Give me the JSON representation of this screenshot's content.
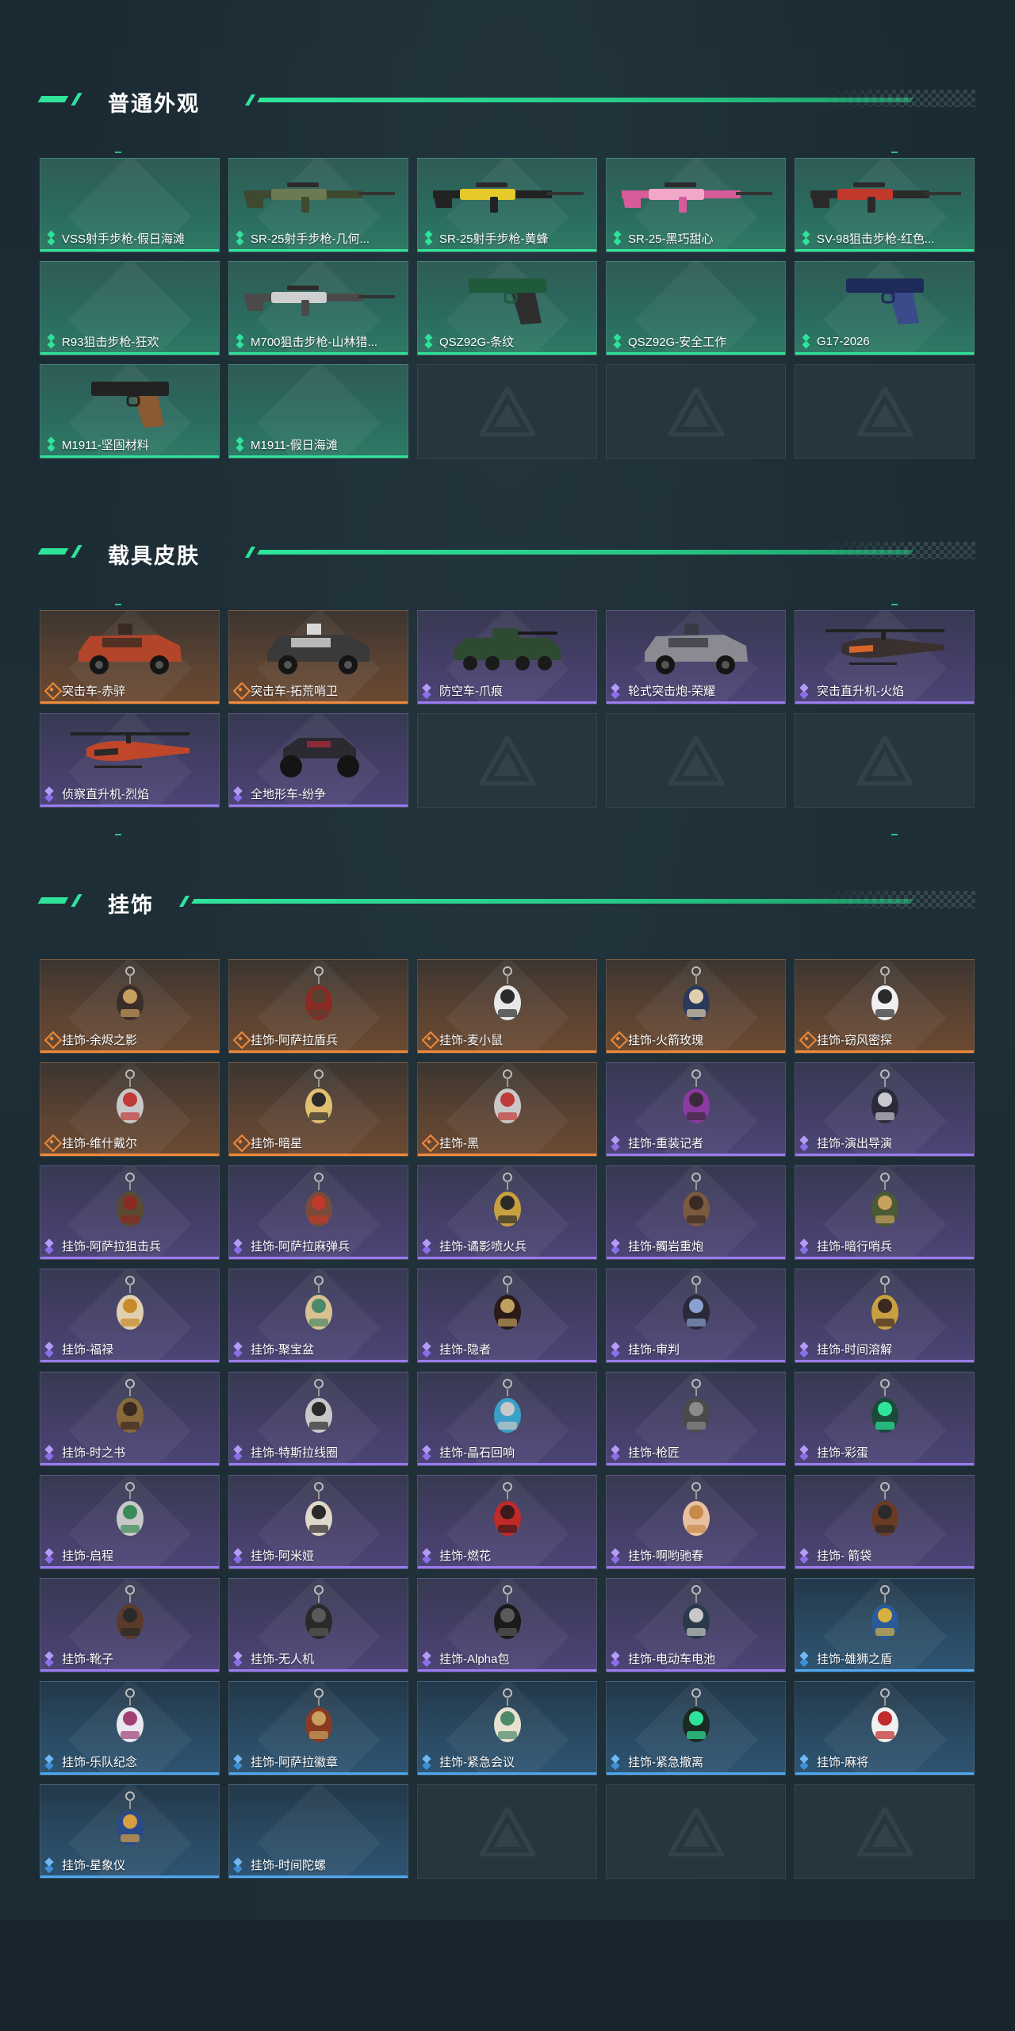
{
  "sections": {
    "weapons": {
      "title": "普通外观",
      "items": [
        {
          "label": "VSS射手步枪-假日海滩",
          "rarity": "green",
          "icon": "none"
        },
        {
          "label": "SR-25射手步枪-几何...",
          "rarity": "green",
          "icon": "rifle-icon",
          "colors": [
            "#3d4a2f",
            "#6b7a52"
          ]
        },
        {
          "label": "SR-25射手步枪-黄蜂",
          "rarity": "green",
          "icon": "rifle-icon",
          "colors": [
            "#222222",
            "#e6c92a"
          ]
        },
        {
          "label": "SR-25-黑巧甜心",
          "rarity": "green",
          "icon": "rifle-icon",
          "colors": [
            "#d75a9a",
            "#f2a6c8"
          ]
        },
        {
          "label": "SV-98狙击步枪-红色...",
          "rarity": "green",
          "icon": "rifle-icon",
          "colors": [
            "#2a2a2a",
            "#c0392b"
          ]
        },
        {
          "label": "R93狙击步枪-狂欢",
          "rarity": "green",
          "icon": "none"
        },
        {
          "label": "M700狙击步枪-山林猎...",
          "rarity": "green",
          "icon": "rifle-icon",
          "colors": [
            "#4a4a4a",
            "#cfcfcf"
          ]
        },
        {
          "label": "QSZ92G-条纹",
          "rarity": "green",
          "icon": "pistol-icon",
          "colors": [
            "#1f5a3a",
            "#2e2e2e"
          ]
        },
        {
          "label": "QSZ92G-安全工作",
          "rarity": "green",
          "icon": "none"
        },
        {
          "label": "G17-2026",
          "rarity": "green",
          "icon": "pistol-icon",
          "colors": [
            "#1e2a5a",
            "#3a4a8a"
          ]
        },
        {
          "label": "M1911-坚固材料",
          "rarity": "green",
          "icon": "pistol-icon",
          "colors": [
            "#222222",
            "#8a5a32"
          ]
        },
        {
          "label": "M1911-假日海滩",
          "rarity": "green",
          "icon": "none"
        },
        {
          "empty": true
        },
        {
          "empty": true
        },
        {
          "empty": true
        }
      ]
    },
    "vehicles": {
      "title": "载具皮肤",
      "items": [
        {
          "label": "突击车-赤骍",
          "rarity": "orange",
          "icon": "armored-car-icon",
          "colors": [
            "#b2452a",
            "#3a2a22"
          ]
        },
        {
          "label": "突击车-拓荒哨卫",
          "rarity": "orange",
          "icon": "armored-car-icon",
          "colors": [
            "#3a3a3a",
            "#d8d8d8"
          ]
        },
        {
          "label": "防空车-爪痕",
          "rarity": "purple",
          "icon": "apc-icon",
          "colors": [
            "#2e4a30",
            "#1a1a1a"
          ]
        },
        {
          "label": "轮式突击炮-荣耀",
          "rarity": "purple",
          "icon": "armored-car-icon",
          "colors": [
            "#8a8a92",
            "#3a3a44"
          ]
        },
        {
          "label": "突击直升机-火焰",
          "rarity": "purple",
          "icon": "helicopter-icon",
          "colors": [
            "#3a3030",
            "#d8662a"
          ]
        },
        {
          "label": "侦察直升机-烈焰",
          "rarity": "purple",
          "icon": "helicopter-icon",
          "colors": [
            "#c0462a",
            "#2a2a2a"
          ]
        },
        {
          "label": "全地形车-纷争",
          "rarity": "purple",
          "icon": "atv-icon",
          "colors": [
            "#2a2a30",
            "#8a2a3a"
          ]
        },
        {
          "empty": true
        },
        {
          "empty": true
        },
        {
          "empty": true
        }
      ]
    },
    "charms": {
      "title": "挂饰",
      "items": [
        {
          "label": "挂饰-余烬之影",
          "rarity": "orange",
          "icon": "charm-icon",
          "colors": [
            "#3a2e28",
            "#c8a060"
          ]
        },
        {
          "label": "挂饰-阿萨拉盾兵",
          "rarity": "orange",
          "icon": "charm-icon",
          "colors": [
            "#8a2a22",
            "#5a4030"
          ]
        },
        {
          "label": "挂饰-麦小鼠",
          "rarity": "orange",
          "icon": "charm-icon",
          "colors": [
            "#e8e8e8",
            "#2a2a2a"
          ]
        },
        {
          "label": "挂饰-火箭玫瑰",
          "rarity": "orange",
          "icon": "charm-icon",
          "colors": [
            "#2a3a5a",
            "#e0d0b0"
          ]
        },
        {
          "label": "挂饰-窃风密探",
          "rarity": "orange",
          "icon": "charm-icon",
          "colors": [
            "#f0f0f0",
            "#2a2a2a"
          ]
        },
        {
          "label": "挂饰-维什戴尔",
          "rarity": "orange",
          "icon": "charm-icon",
          "colors": [
            "#c8c8c8",
            "#c03a3a"
          ]
        },
        {
          "label": "挂饰-暗星",
          "rarity": "orange",
          "icon": "charm-icon",
          "colors": [
            "#e0c070",
            "#2a2a2a"
          ]
        },
        {
          "label": "挂饰-黑",
          "rarity": "orange",
          "icon": "charm-icon",
          "colors": [
            "#c8c8c8",
            "#c03a3a"
          ]
        },
        {
          "label": "挂饰-重装记者",
          "rarity": "purple",
          "icon": "charm-icon",
          "colors": [
            "#8a3aa0",
            "#3a2a3a"
          ]
        },
        {
          "label": "挂饰-演出导演",
          "rarity": "purple",
          "icon": "charm-icon",
          "colors": [
            "#2a2a3a",
            "#c8c8d0"
          ]
        },
        {
          "label": "挂饰-阿萨拉狙击兵",
          "rarity": "purple",
          "icon": "charm-icon",
          "colors": [
            "#5a4a32",
            "#8a2a22"
          ]
        },
        {
          "label": "挂饰-阿萨拉麻弹兵",
          "rarity": "purple",
          "icon": "charm-icon",
          "colors": [
            "#7a4a3a",
            "#c03a2a"
          ]
        },
        {
          "label": "挂饰-谲影喷火兵",
          "rarity": "purple",
          "icon": "charm-icon",
          "colors": [
            "#c8a040",
            "#2a2a2a"
          ]
        },
        {
          "label": "挂饰-髑岩重炮",
          "rarity": "purple",
          "icon": "charm-icon",
          "colors": [
            "#7a5a40",
            "#3a2a22"
          ]
        },
        {
          "label": "挂饰-暗行哨兵",
          "rarity": "purple",
          "icon": "charm-icon",
          "colors": [
            "#4a5a32",
            "#c8a060"
          ]
        },
        {
          "label": "挂饰-福禄",
          "rarity": "purple",
          "icon": "charm-icon",
          "colors": [
            "#e0d0b0",
            "#c88a2a"
          ]
        },
        {
          "label": "挂饰-聚宝盆",
          "rarity": "purple",
          "icon": "charm-icon",
          "colors": [
            "#d8c090",
            "#4a8a6a"
          ]
        },
        {
          "label": "挂饰-隐者",
          "rarity": "purple",
          "icon": "charm-icon",
          "colors": [
            "#2a1a1a",
            "#c0a060"
          ]
        },
        {
          "label": "挂饰-审判",
          "rarity": "purple",
          "icon": "charm-icon",
          "colors": [
            "#2a2a3a",
            "#8aa0d0"
          ]
        },
        {
          "label": "挂饰-时间溶解",
          "rarity": "purple",
          "icon": "charm-icon",
          "colors": [
            "#c8a040",
            "#3a2a22"
          ]
        },
        {
          "label": "挂饰-时之书",
          "rarity": "purple",
          "icon": "charm-icon",
          "colors": [
            "#8a6a3a",
            "#3a2a22"
          ]
        },
        {
          "label": "挂饰-特斯拉线圈",
          "rarity": "purple",
          "icon": "charm-icon",
          "colors": [
            "#c8c8c8",
            "#2a2a2a"
          ]
        },
        {
          "label": "挂饰-晶石回响",
          "rarity": "purple",
          "icon": "charm-icon",
          "colors": [
            "#3aa0c8",
            "#c8c8c8"
          ]
        },
        {
          "label": "挂饰-枪匠",
          "rarity": "purple",
          "icon": "charm-icon",
          "colors": [
            "#4a4a4a",
            "#8a8a8a"
          ]
        },
        {
          "label": "挂饰-彩蛋",
          "rarity": "purple",
          "icon": "charm-icon",
          "colors": [
            "#1a4a3a",
            "#2fe49a"
          ]
        },
        {
          "label": "挂饰-启程",
          "rarity": "purple",
          "icon": "charm-icon",
          "colors": [
            "#c8c8c8",
            "#3a8a5a"
          ]
        },
        {
          "label": "挂饰-阿米娅",
          "rarity": "purple",
          "icon": "charm-icon",
          "colors": [
            "#e0d8c8",
            "#2a2a2a"
          ]
        },
        {
          "label": "挂饰-燃花",
          "rarity": "purple",
          "icon": "charm-icon",
          "colors": [
            "#c02a2a",
            "#3a1a1a"
          ]
        },
        {
          "label": "挂饰-啊哟驰春",
          "rarity": "purple",
          "icon": "charm-icon",
          "colors": [
            "#e8c0a0",
            "#c88a4a"
          ]
        },
        {
          "label": "挂饰- 箭袋",
          "rarity": "purple",
          "icon": "charm-icon",
          "colors": [
            "#6a3a22",
            "#2a2a2a"
          ]
        },
        {
          "label": "挂饰-靴子",
          "rarity": "purple",
          "icon": "charm-icon",
          "colors": [
            "#5a3a2a",
            "#2a2a2a"
          ]
        },
        {
          "label": "挂饰-无人机",
          "rarity": "purple",
          "icon": "charm-icon",
          "colors": [
            "#2a2a2a",
            "#5a5a5a"
          ]
        },
        {
          "label": "挂饰-Alpha包",
          "rarity": "purple",
          "icon": "charm-icon",
          "colors": [
            "#1a1a1a",
            "#5a5a5a"
          ]
        },
        {
          "label": "挂饰-电动车电池",
          "rarity": "purple",
          "icon": "charm-icon",
          "colors": [
            "#2a3a4a",
            "#c8c8c8"
          ]
        },
        {
          "label": "挂饰-雄狮之盾",
          "rarity": "blue",
          "icon": "charm-icon",
          "colors": [
            "#2a5a9a",
            "#d8b040"
          ]
        },
        {
          "label": "挂饰-乐队纪念",
          "rarity": "blue",
          "icon": "charm-icon",
          "colors": [
            "#e8e8f0",
            "#a04070"
          ]
        },
        {
          "label": "挂饰-阿萨拉徽章",
          "rarity": "blue",
          "icon": "charm-icon",
          "colors": [
            "#8a3a22",
            "#c8a060"
          ]
        },
        {
          "label": "挂饰-紧急会议",
          "rarity": "blue",
          "icon": "charm-icon",
          "colors": [
            "#e8e0d0",
            "#4a8a6a"
          ]
        },
        {
          "label": "挂饰-紧急撤离",
          "rarity": "blue",
          "icon": "charm-icon",
          "colors": [
            "#1a2a22",
            "#2fe49a"
          ]
        },
        {
          "label": "挂饰-麻将",
          "rarity": "blue",
          "icon": "charm-icon",
          "colors": [
            "#f0f0f0",
            "#c02a2a"
          ]
        },
        {
          "label": "挂饰-星象仪",
          "rarity": "blue",
          "icon": "charm-icon",
          "colors": [
            "#2a4a8a",
            "#d8a040"
          ]
        },
        {
          "label": "挂饰-时间陀螺",
          "rarity": "blue",
          "icon": "none"
        },
        {
          "empty": true
        },
        {
          "empty": true
        },
        {
          "empty": true
        }
      ]
    }
  },
  "colors": {
    "accent": "#2fe49a",
    "rarity_green": "#2fe49a",
    "rarity_orange": "#ef8a3a",
    "rarity_purple": "#9a7bf0",
    "rarity_blue": "#4fa8f0",
    "background": "#1a2830"
  }
}
